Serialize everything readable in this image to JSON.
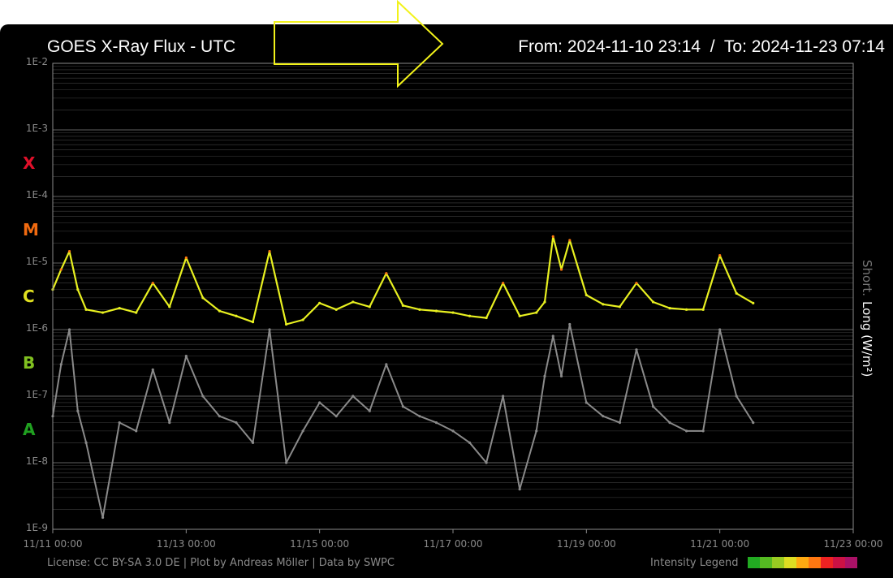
{
  "header": {
    "title": "GOES X-Ray Flux - UTC",
    "range": "From: 2024-11-10 23:14  /  To: 2024-11-23 07:14"
  },
  "footer": {
    "license": "License: CC BY-SA 3.0 DE | Plot by Andreas Möller | Data by SWPC",
    "legend_label": "Intensity Legend",
    "legend_colors": [
      "#22aa22",
      "#55bb22",
      "#99cc22",
      "#dddd22",
      "#ffaa11",
      "#ff7711",
      "#ee2222",
      "#cc1144",
      "#aa1166"
    ]
  },
  "colors": {
    "background": "#000000",
    "grid": "#6a6a6a",
    "long_series": "#e8f020",
    "long_peaks": "#ff7a10",
    "short_series": "#8a8a8a",
    "arrow_outline": "#f2f21a",
    "class_X": "#e0102a",
    "class_M": "#f06a10",
    "class_C": "#e0e020",
    "class_B": "#80c020",
    "class_A": "#20a020"
  },
  "chart_data": {
    "type": "line",
    "title": "GOES X-Ray Flux - UTC",
    "ylabel_short": "Short",
    "ylabel_sep": ".",
    "ylabel_long": "Long (W/m²)",
    "yscale": "log",
    "ylim": [
      1e-09,
      0.01
    ],
    "y_tick_labels": [
      "1E-9",
      "1E-8",
      "1E-7",
      "1E-6",
      "1E-5",
      "1E-4",
      "1E-3",
      "1E-2"
    ],
    "flare_classes": [
      {
        "name": "X",
        "level": 0.0001
      },
      {
        "name": "M",
        "level": 1e-05
      },
      {
        "name": "C",
        "level": 1e-06
      },
      {
        "name": "B",
        "level": 1e-07
      },
      {
        "name": "A",
        "level": 1e-08
      }
    ],
    "x_start": "2024-11-11 00:00",
    "x_end": "2024-11-23 00:00",
    "x_tick_labels": [
      "11/11 00:00",
      "11/13 00:00",
      "11/15 00:00",
      "11/17 00:00",
      "11/19 00:00",
      "11/21 00:00",
      "11/23 00:00"
    ],
    "grid": true,
    "series": [
      {
        "name": "Long",
        "x": [
          "2024-11-11 00:00",
          "2024-11-11 03:00",
          "2024-11-11 06:00",
          "2024-11-11 09:00",
          "2024-11-11 12:00",
          "2024-11-11 18:00",
          "2024-11-12 00:00",
          "2024-11-12 06:00",
          "2024-11-12 12:00",
          "2024-11-12 18:00",
          "2024-11-13 00:00",
          "2024-11-13 06:00",
          "2024-11-13 12:00",
          "2024-11-13 18:00",
          "2024-11-14 00:00",
          "2024-11-14 06:00",
          "2024-11-14 12:00",
          "2024-11-14 18:00",
          "2024-11-15 00:00",
          "2024-11-15 06:00",
          "2024-11-15 12:00",
          "2024-11-15 18:00",
          "2024-11-16 00:00",
          "2024-11-16 06:00",
          "2024-11-16 12:00",
          "2024-11-16 18:00",
          "2024-11-17 00:00",
          "2024-11-17 06:00",
          "2024-11-17 12:00",
          "2024-11-17 18:00",
          "2024-11-18 00:00",
          "2024-11-18 06:00",
          "2024-11-18 09:00",
          "2024-11-18 12:00",
          "2024-11-18 15:00",
          "2024-11-18 18:00",
          "2024-11-19 00:00",
          "2024-11-19 06:00",
          "2024-11-19 12:00",
          "2024-11-19 18:00",
          "2024-11-20 00:00",
          "2024-11-20 06:00",
          "2024-11-20 12:00",
          "2024-11-20 18:00",
          "2024-11-21 00:00",
          "2024-11-21 06:00",
          "2024-11-21 12:00"
        ],
        "values": [
          4e-06,
          8e-06,
          1.5e-05,
          4e-06,
          2e-06,
          1.8e-06,
          2.1e-06,
          1.8e-06,
          5e-06,
          2.2e-06,
          1.2e-05,
          3e-06,
          1.9e-06,
          1.6e-06,
          1.3e-06,
          1.5e-05,
          1.2e-06,
          1.4e-06,
          2.5e-06,
          2e-06,
          2.6e-06,
          2.2e-06,
          7e-06,
          2.3e-06,
          2e-06,
          1.9e-06,
          1.8e-06,
          1.6e-06,
          1.5e-06,
          5e-06,
          1.6e-06,
          1.8e-06,
          2.6e-06,
          2.5e-05,
          8e-06,
          2.2e-05,
          3.3e-06,
          2.4e-06,
          2.2e-06,
          5e-06,
          2.6e-06,
          2.1e-06,
          2e-06,
          2e-06,
          1.3e-05,
          3.5e-06,
          2.5e-06
        ]
      },
      {
        "name": "Short",
        "x": [
          "2024-11-11 00:00",
          "2024-11-11 03:00",
          "2024-11-11 06:00",
          "2024-11-11 09:00",
          "2024-11-11 12:00",
          "2024-11-11 18:00",
          "2024-11-12 00:00",
          "2024-11-12 06:00",
          "2024-11-12 12:00",
          "2024-11-12 18:00",
          "2024-11-13 00:00",
          "2024-11-13 06:00",
          "2024-11-13 12:00",
          "2024-11-13 18:00",
          "2024-11-14 00:00",
          "2024-11-14 06:00",
          "2024-11-14 12:00",
          "2024-11-14 18:00",
          "2024-11-15 00:00",
          "2024-11-15 06:00",
          "2024-11-15 12:00",
          "2024-11-15 18:00",
          "2024-11-16 00:00",
          "2024-11-16 06:00",
          "2024-11-16 12:00",
          "2024-11-16 18:00",
          "2024-11-17 00:00",
          "2024-11-17 06:00",
          "2024-11-17 12:00",
          "2024-11-17 18:00",
          "2024-11-18 00:00",
          "2024-11-18 06:00",
          "2024-11-18 09:00",
          "2024-11-18 12:00",
          "2024-11-18 15:00",
          "2024-11-18 18:00",
          "2024-11-19 00:00",
          "2024-11-19 06:00",
          "2024-11-19 12:00",
          "2024-11-19 18:00",
          "2024-11-20 00:00",
          "2024-11-20 06:00",
          "2024-11-20 12:00",
          "2024-11-20 18:00",
          "2024-11-21 00:00",
          "2024-11-21 06:00",
          "2024-11-21 12:00"
        ],
        "values": [
          5e-08,
          3e-07,
          1e-06,
          6e-08,
          2e-08,
          1.5e-09,
          4e-08,
          3e-08,
          2.5e-07,
          4e-08,
          4e-07,
          1e-07,
          5e-08,
          4e-08,
          2e-08,
          1e-06,
          1e-08,
          3e-08,
          8e-08,
          5e-08,
          1e-07,
          6e-08,
          3e-07,
          7e-08,
          5e-08,
          4e-08,
          3e-08,
          2e-08,
          1e-08,
          1e-07,
          4e-09,
          3e-08,
          2e-07,
          8e-07,
          2e-07,
          1.2e-06,
          8e-08,
          5e-08,
          4e-08,
          5e-07,
          7e-08,
          4e-08,
          3e-08,
          3e-08,
          1e-06,
          1e-07,
          4e-08
        ]
      }
    ]
  }
}
